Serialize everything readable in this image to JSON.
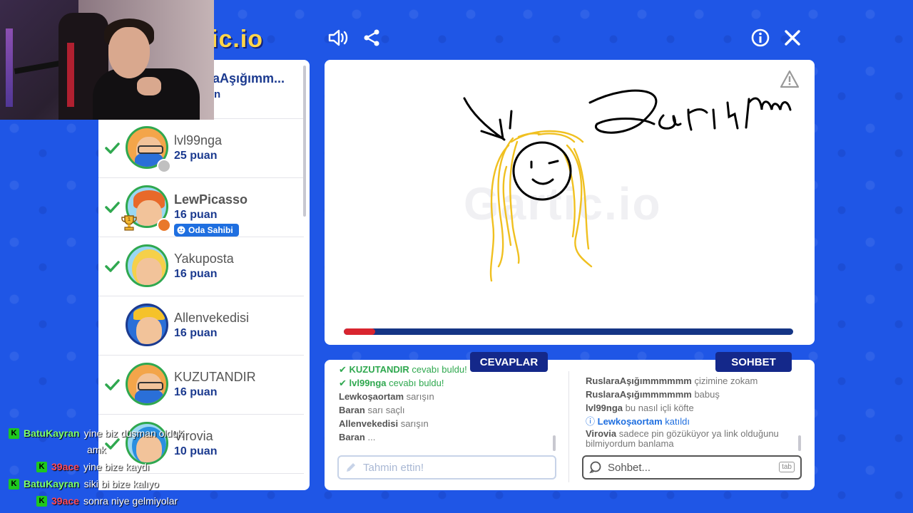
{
  "app": {
    "logo_text": "ic.io"
  },
  "top_icons": [
    "speaker-icon",
    "share-icon",
    "info-icon",
    "close-icon"
  ],
  "players": {
    "first": {
      "name": "aAşığımm...",
      "score": "n"
    },
    "list": [
      {
        "name": "lvl99nga",
        "score": "25 puan",
        "guessed": true
      },
      {
        "name": "LewPicasso",
        "score": "16 puan",
        "guessed": true,
        "badge": "Oda Sahibi",
        "rank": "1"
      },
      {
        "name": "Yakuposta",
        "score": "16 puan",
        "guessed": true
      },
      {
        "name": "Allenvekedisi",
        "score": "16 puan",
        "guessed": false
      },
      {
        "name": "KUZUTANDIR",
        "score": "16 puan",
        "guessed": true
      },
      {
        "name": "Virovia",
        "score": "10 puan",
        "guessed": true
      }
    ]
  },
  "canvas": {
    "watermark": "Gartic.io",
    "drawing_text": "Sarışımm",
    "progress_fraction": 0.07
  },
  "answers": {
    "title": "CEVAPLAR",
    "messages": [
      {
        "user": "KUZUTANDIR",
        "text": "cevabı buldu!",
        "type": "found"
      },
      {
        "user": "lvl99nga",
        "text": "cevabı buldu!",
        "type": "found"
      },
      {
        "user": "Lewkoşaortam",
        "text": "sarışın",
        "type": "normal"
      },
      {
        "user": "Baran",
        "text": "sarı saçlı",
        "type": "normal"
      },
      {
        "user": "Allenvekedisi",
        "text": "sarışın",
        "type": "normal"
      },
      {
        "user": "Baran",
        "text": "...",
        "type": "normal"
      }
    ],
    "placeholder": "Tahmin ettin!"
  },
  "chat": {
    "title": "SOHBET",
    "messages": [
      {
        "user": "RuslaraAşığımmmmmm",
        "text": "çizimine zokam",
        "type": "normal"
      },
      {
        "user": "RuslaraAşığımmmmmm",
        "text": "babuş",
        "type": "normal"
      },
      {
        "user": "lvl99nga",
        "text": "bu nasıl içli köfte",
        "type": "normal"
      },
      {
        "user": "Lewkoşaortam",
        "text": "katıldı",
        "type": "joined"
      },
      {
        "user": "Virovia",
        "text": "sadece pin gözüküyor ya link olduğunu",
        "type": "normal"
      },
      {
        "user": "",
        "text": "bilmiyordum banlama",
        "type": "cont"
      }
    ],
    "placeholder": "Sohbet...",
    "tab_hint": "tab"
  },
  "stream_chat": [
    {
      "user": "BatuKayran",
      "text": "yine biz düşman olduk",
      "color": "green",
      "icon": false
    },
    {
      "user": "",
      "text": "amk",
      "color": "none",
      "icon": false
    },
    {
      "user": "39ace",
      "text": "yine bize kaydı",
      "color": "red",
      "icon": true
    },
    {
      "user": "BatuKayran",
      "text": "siki bi bize kalıyo",
      "color": "green",
      "icon": true
    },
    {
      "user": "39ace",
      "text": "sonra niye gelmiyolar",
      "color": "red",
      "icon": true
    }
  ]
}
